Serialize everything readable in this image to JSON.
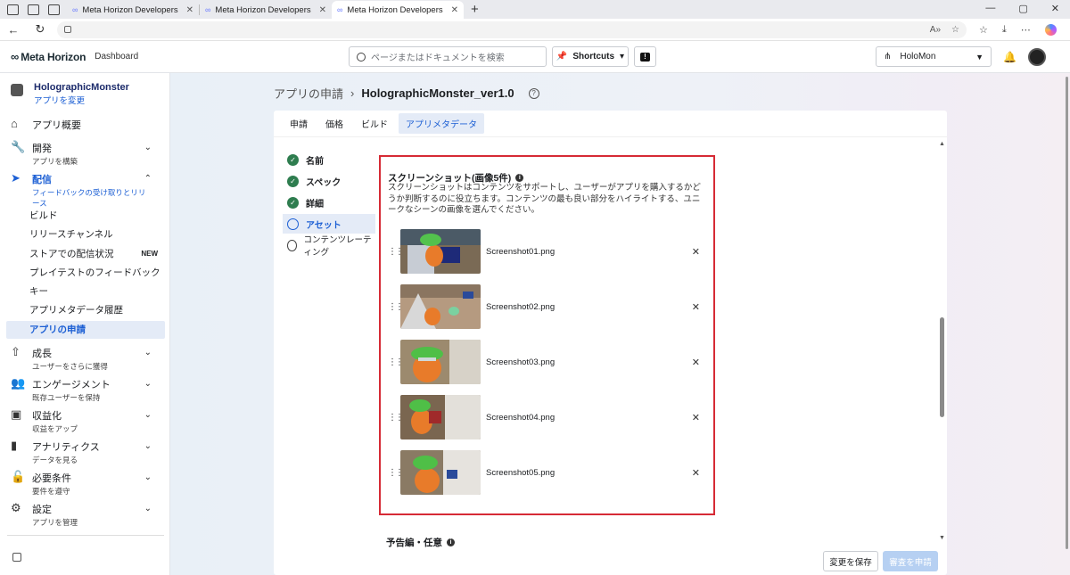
{
  "browser": {
    "tabs": [
      {
        "title": "Meta Horizon Developers",
        "active": false
      },
      {
        "title": "Meta Horizon Developers",
        "active": false
      },
      {
        "title": "Meta Horizon Developers",
        "active": true
      }
    ],
    "new_tab": "+",
    "window_controls": [
      "—",
      "▢",
      "✕"
    ]
  },
  "header": {
    "logo": "∞",
    "brand": "Meta Horizon",
    "dashboard": "Dashboard",
    "search_placeholder": "ページまたはドキュメントを検索",
    "shortcuts_label": "Shortcuts",
    "app_selector": "HoloMon"
  },
  "sidebar": {
    "project_name": "HolographicMonster",
    "project_change": "アプリを変更",
    "items": [
      {
        "label": "アプリ概要",
        "sub": "",
        "icon": "home-icon"
      },
      {
        "label": "開発",
        "sub": "アプリを構築",
        "icon": "wrench-icon"
      },
      {
        "label": "配信",
        "sub": "フィードバックの受け取りとリリース",
        "icon": "send-icon"
      },
      {
        "label": "成長",
        "sub": "ユーザーをさらに獲得",
        "icon": "growth-icon"
      },
      {
        "label": "エンゲージメント",
        "sub": "既存ユーザーを保持",
        "icon": "people-icon"
      },
      {
        "label": "収益化",
        "sub": "収益をアップ",
        "icon": "money-icon"
      },
      {
        "label": "アナリティクス",
        "sub": "データを見る",
        "icon": "chart-icon"
      },
      {
        "label": "必要条件",
        "sub": "要件を遵守",
        "icon": "lock-icon"
      },
      {
        "label": "設定",
        "sub": "アプリを管理",
        "icon": "gear-icon"
      }
    ],
    "sub_items": [
      {
        "label": "ビルド"
      },
      {
        "label": "リリースチャンネル"
      },
      {
        "label": "ストアでの配信状況",
        "badge": "NEW"
      },
      {
        "label": "プレイテストのフィードバック"
      },
      {
        "label": "キー"
      },
      {
        "label": "アプリメタデータ履歴"
      },
      {
        "label": "アプリの申請"
      }
    ]
  },
  "breadcrumb": {
    "parent": "アプリの申請",
    "current": "HolographicMonster_ver1.0"
  },
  "tabs": [
    "申請",
    "価格",
    "ビルド",
    "アプリメタデータ"
  ],
  "steps": [
    {
      "label": "名前",
      "state": "done"
    },
    {
      "label": "スペック",
      "state": "done"
    },
    {
      "label": "詳細",
      "state": "done"
    },
    {
      "label": "アセット",
      "state": "current"
    },
    {
      "label": "コンテンツレーティング",
      "state": "todo"
    }
  ],
  "screenshots": {
    "heading": "スクリーンショット(画像5件)",
    "description": "スクリーンショットはコンテンツをサポートし、ユーザーがアプリを購入するかどうか判断するのに役立ちます。コンテンツの最も良い部分をハイライトする、ユニークなシーンの画像を選んでください。",
    "files": [
      "Screenshot01.png",
      "Screenshot02.png",
      "Screenshot03.png",
      "Screenshot04.png",
      "Screenshot05.png"
    ]
  },
  "preview_heading": "予告編・任意",
  "buttons": {
    "save": "変更を保存",
    "submit": "審査を申請"
  }
}
